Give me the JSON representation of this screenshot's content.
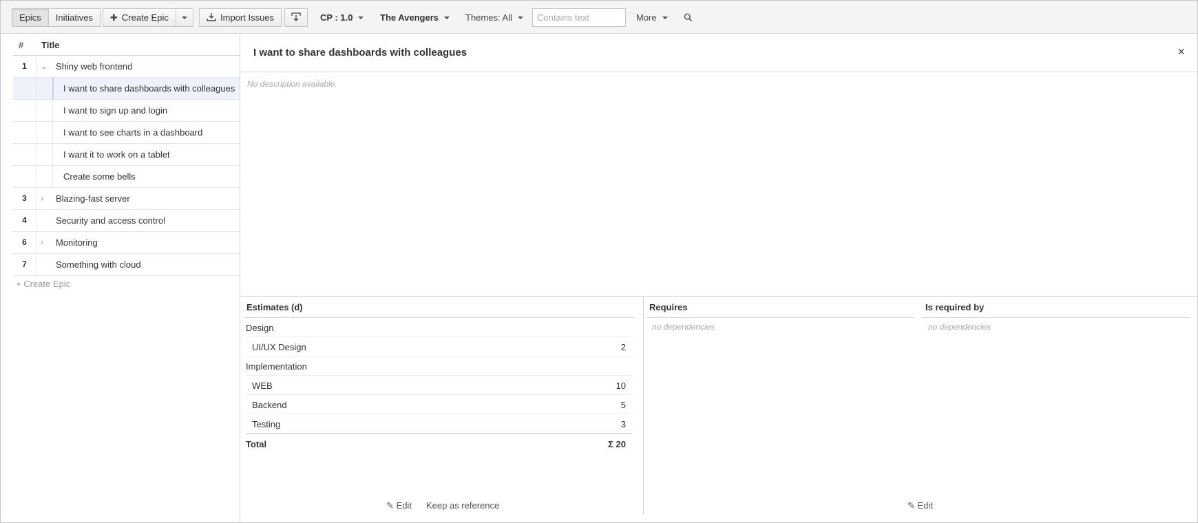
{
  "toolbar": {
    "epics_tab": "Epics",
    "initiatives_tab": "Initiatives",
    "create_epic_label": "Create Epic",
    "import_issues_label": "Import Issues",
    "cp_filter": "CP : 1.0",
    "team_filter": "The Avengers",
    "themes_filter": "Themes: All",
    "search_placeholder": "Contains text",
    "more_label": "More",
    "icons": {
      "create": "plus-icon",
      "import": "download-icon",
      "export": "export-icon",
      "search": "search-icon"
    }
  },
  "epic_list": {
    "header_num": "#",
    "header_title": "Title",
    "create_epic_link": "+ Create Epic",
    "rows": [
      {
        "num": "1",
        "title": "Shiny web frontend",
        "toggle": "⌄"
      },
      {
        "child": "I want to share dashboards with colleagues",
        "selected": true
      },
      {
        "child": "I want to sign up and login"
      },
      {
        "child": "I want to see charts in a dashboard"
      },
      {
        "child": "I want it to work on a tablet"
      },
      {
        "child": "Create some bells"
      },
      {
        "num": "3",
        "title": "Blazing-fast server",
        "toggle": "›"
      },
      {
        "num": "4",
        "title": "Security and access control"
      },
      {
        "num": "6",
        "title": "Monitoring",
        "toggle": "›"
      },
      {
        "num": "7",
        "title": "Something with cloud"
      }
    ]
  },
  "detail": {
    "title": "I want to share dashboards with colleagues",
    "close_glyph": "×",
    "description": "No description available.",
    "estimates": {
      "title": "Estimates (d)",
      "groups": [
        {
          "name": "Design",
          "items": [
            {
              "name": "UI/UX Design",
              "value": "2"
            }
          ]
        },
        {
          "name": "Implementation",
          "items": [
            {
              "name": "WEB",
              "value": "10"
            },
            {
              "name": "Backend",
              "value": "5"
            },
            {
              "name": "Testing",
              "value": "3"
            }
          ]
        }
      ],
      "total_label": "Total",
      "total_value": "Σ 20",
      "edit_label": "Edit",
      "keep_label": "Keep as reference"
    },
    "requires": {
      "title": "Requires",
      "empty": "no dependencies"
    },
    "required_by": {
      "title": "Is required by",
      "empty": "no dependencies",
      "edit_label": "Edit"
    }
  }
}
